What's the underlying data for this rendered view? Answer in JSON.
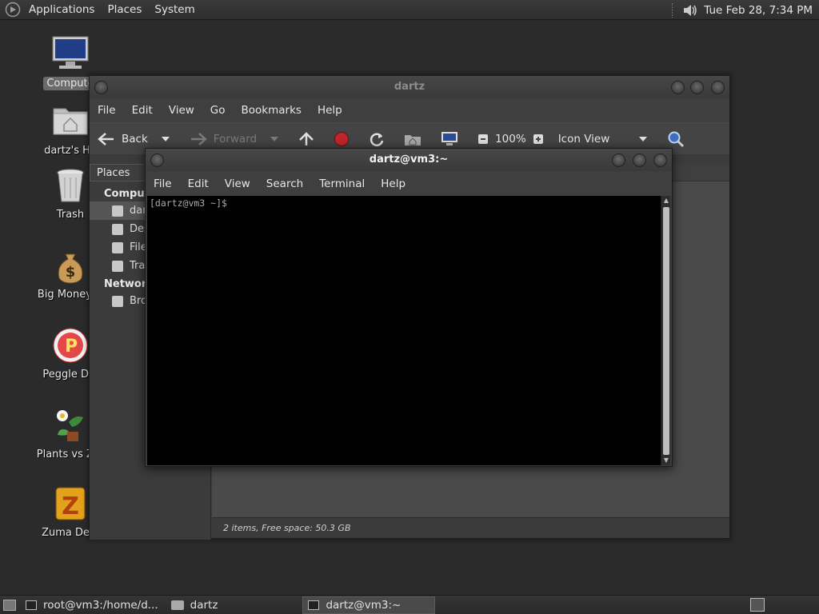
{
  "top_panel": {
    "menus": [
      "Applications",
      "Places",
      "System"
    ],
    "clock": "Tue Feb 28, 7:34 PM"
  },
  "desktop_icons": [
    {
      "label": "Compute",
      "icon": "computer-icon"
    },
    {
      "label": "dartz's Ho",
      "icon": "home-folder-icon"
    },
    {
      "label": "Trash",
      "icon": "trash-icon"
    },
    {
      "label": "Big Money D",
      "icon": "money-bag-icon"
    },
    {
      "label": "Peggle Del",
      "icon": "peggle-icon"
    },
    {
      "label": "Plants vs Zor",
      "icon": "plants-icon"
    },
    {
      "label": "Zuma Delu",
      "icon": "zuma-icon"
    }
  ],
  "file_manager": {
    "title": "dartz",
    "menus": [
      "File",
      "Edit",
      "View",
      "Go",
      "Bookmarks",
      "Help"
    ],
    "toolbar": {
      "back": "Back",
      "forward": "Forward",
      "zoom": "100%",
      "view_mode": "Icon View"
    },
    "sidebar": {
      "header": "Places",
      "computer_heading": "Comput",
      "items": [
        "dar",
        "Des",
        "File",
        "Tra"
      ],
      "network_heading": "Network",
      "network_items": [
        "Bro"
      ]
    },
    "status": "2 items, Free space: 50.3 GB"
  },
  "terminal": {
    "title": "dartz@vm3:~",
    "menus": [
      "File",
      "Edit",
      "View",
      "Search",
      "Terminal",
      "Help"
    ],
    "prompt": "[dartz@vm3 ~]$"
  },
  "bottom_panel": {
    "tasks": [
      "root@vm3:/home/d...",
      "dartz",
      "dartz@vm3:~"
    ]
  },
  "colors": {
    "desktop_bg": "#2b2b2b",
    "window_bg": "#3b3b3b",
    "terminal_bg": "#000000",
    "stop_red": "#c0262c"
  }
}
